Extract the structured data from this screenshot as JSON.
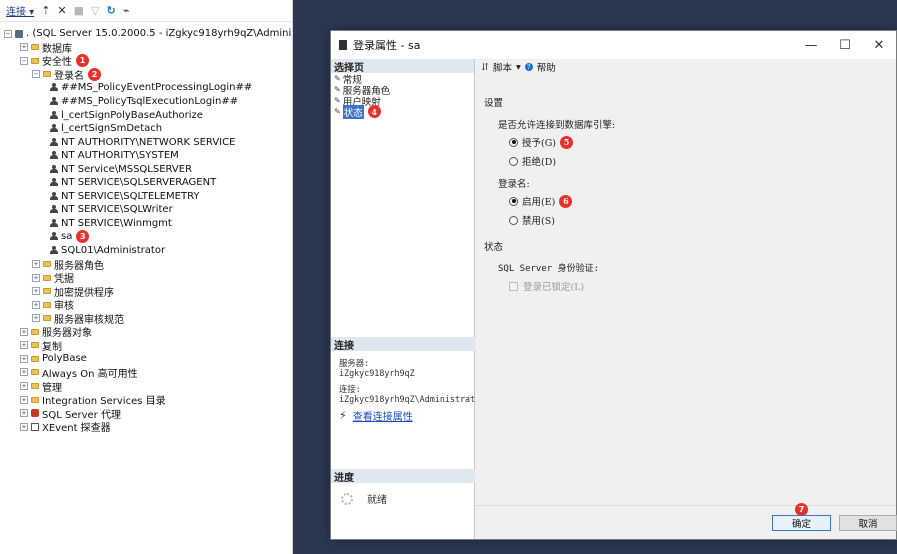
{
  "toolbar": {
    "connect_label": "连接 ▾",
    "icons": [
      "connect-object-explorer-icon",
      "disconnect-icon",
      "stop-icon",
      "filter-icon",
      "refresh-icon",
      "activity-monitor-icon"
    ]
  },
  "tree": {
    "server": ". (SQL Server 15.0.2000.5 - iZgkyc918yrh9qZ\\Administr",
    "databases": "数据库",
    "security": "安全性",
    "logins": "登录名",
    "login_items": [
      "##MS_PolicyEventProcessingLogin##",
      "##MS_PolicyTsqlExecutionLogin##",
      "l_certSignPolyBaseAuthorize",
      "l_certSignSmDetach",
      "NT AUTHORITY\\NETWORK SERVICE",
      "NT AUTHORITY\\SYSTEM",
      "NT Service\\MSSQLSERVER",
      "NT SERVICE\\SQLSERVERAGENT",
      "NT SERVICE\\SQLTELEMETRY",
      "NT SERVICE\\SQLWriter",
      "NT SERVICE\\Winmgmt",
      "sa",
      "SQL01\\Administrator"
    ],
    "security_children": [
      "服务器角色",
      "凭据",
      "加密提供程序",
      "审核",
      "服务器审核规范"
    ],
    "top_nodes": [
      "服务器对象",
      "复制",
      "PolyBase",
      "Always On 高可用性",
      "管理",
      "Integration Services 目录"
    ],
    "agent": "SQL Server 代理",
    "xevent": "XEvent 探查器"
  },
  "badges": [
    "1",
    "2",
    "3",
    "4",
    "5",
    "6",
    "7"
  ],
  "colors": {
    "accent": "#3b74c9",
    "badge": "#e8312a",
    "backdrop": "#2a3852"
  },
  "dialog": {
    "title": "登录属性 - sa",
    "window_buttons": {
      "minimize": "—",
      "maximize": "☐",
      "close": "✕"
    },
    "select_page_header": "选择页",
    "pages": [
      "常规",
      "服务器角色",
      "用户映射",
      "状态"
    ],
    "toolbar": {
      "script": "脚本",
      "dropdown": "▾",
      "help": "帮助"
    },
    "settings": {
      "section_title": "设置",
      "permission_label": "是否允许连接到数据库引擎:",
      "grant": "授予(G)",
      "deny": "拒绝(D)",
      "login_label": "登录名:",
      "enabled": "启用(E)",
      "disabled": "禁用(S)",
      "status_title": "状态",
      "auth_label": "SQL Server 身份验证:",
      "locked_label": "登录已锁定(L)"
    },
    "connection": {
      "header": "连接",
      "server_label": "服务器:",
      "server_value": "iZgkyc918yrh9qZ",
      "conn_label": "连接:",
      "conn_value": "iZgkyc918yrh9qZ\\Administrat",
      "link": "查看连接属性"
    },
    "progress": {
      "header": "进度",
      "status": "就绪"
    },
    "buttons": {
      "ok": "确定",
      "cancel": "取消"
    }
  }
}
